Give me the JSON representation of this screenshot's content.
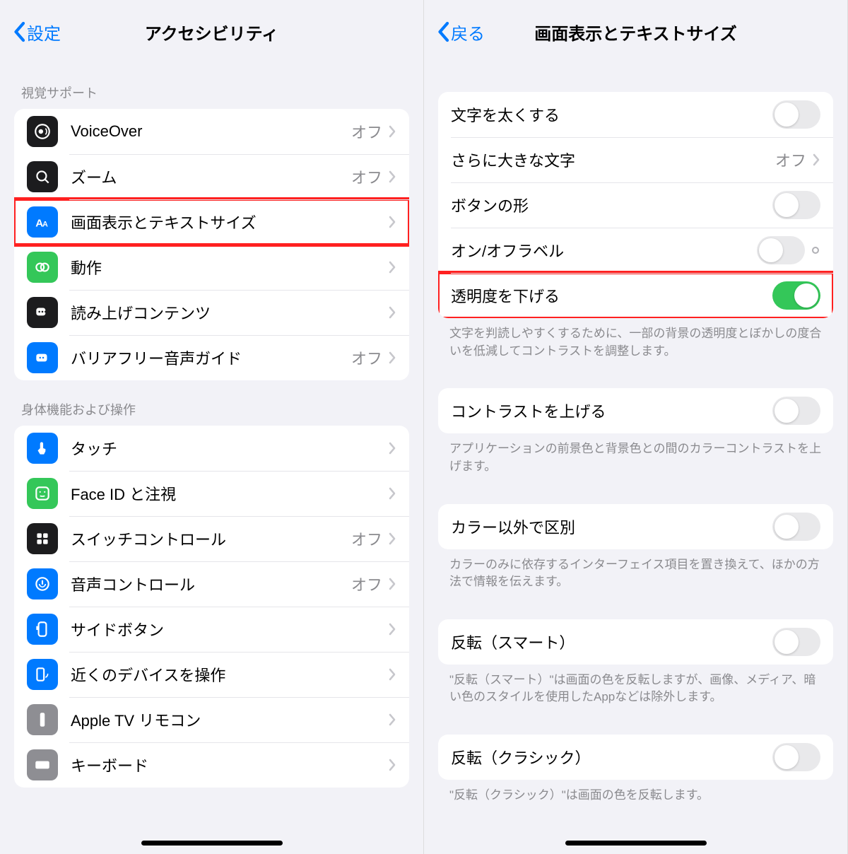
{
  "left": {
    "back": "設定",
    "title": "アクセシビリティ",
    "sec1": "視覚サポート",
    "rows1": [
      {
        "label": "VoiceOver",
        "status": "オフ"
      },
      {
        "label": "ズーム",
        "status": "オフ"
      },
      {
        "label": "画面表示とテキストサイズ",
        "status": ""
      },
      {
        "label": "動作",
        "status": ""
      },
      {
        "label": "読み上げコンテンツ",
        "status": ""
      },
      {
        "label": "バリアフリー音声ガイド",
        "status": "オフ"
      }
    ],
    "sec2": "身体機能および操作",
    "rows2": [
      {
        "label": "タッチ",
        "status": ""
      },
      {
        "label": "Face ID と注視",
        "status": ""
      },
      {
        "label": "スイッチコントロール",
        "status": "オフ"
      },
      {
        "label": "音声コントロール",
        "status": "オフ"
      },
      {
        "label": "サイドボタン",
        "status": ""
      },
      {
        "label": "近くのデバイスを操作",
        "status": ""
      },
      {
        "label": "Apple TV リモコン",
        "status": ""
      },
      {
        "label": "キーボード",
        "status": ""
      }
    ]
  },
  "right": {
    "back": "戻る",
    "title": "画面表示とテキストサイズ",
    "rows1": [
      {
        "label": "文字を太くする",
        "type": "toggle",
        "on": false
      },
      {
        "label": "さらに大きな文字",
        "type": "link",
        "status": "オフ"
      },
      {
        "label": "ボタンの形",
        "type": "toggle",
        "on": false
      },
      {
        "label": "オン/オフラベル",
        "type": "toggle",
        "on": false,
        "dot": true
      },
      {
        "label": "透明度を下げる",
        "type": "toggle",
        "on": true
      }
    ],
    "note1": "文字を判読しやすくするために、一部の背景の透明度とぼかしの度合いを低減してコントラストを調整します。",
    "rows2": [
      {
        "label": "コントラストを上げる",
        "type": "toggle",
        "on": false
      }
    ],
    "note2": "アプリケーションの前景色と背景色との間のカラーコントラストを上げます。",
    "rows3": [
      {
        "label": "カラー以外で区別",
        "type": "toggle",
        "on": false
      }
    ],
    "note3": "カラーのみに依存するインターフェイス項目を置き換えて、ほかの方法で情報を伝えます。",
    "rows4": [
      {
        "label": "反転（スマート）",
        "type": "toggle",
        "on": false
      }
    ],
    "note4": "\"反転（スマート）\"は画面の色を反転しますが、画像、メディア、暗い色のスタイルを使用したAppなどは除外します。",
    "rows5": [
      {
        "label": "反転（クラシック）",
        "type": "toggle",
        "on": false
      }
    ],
    "note5": "\"反転（クラシック）\"は画面の色を反転します。"
  }
}
